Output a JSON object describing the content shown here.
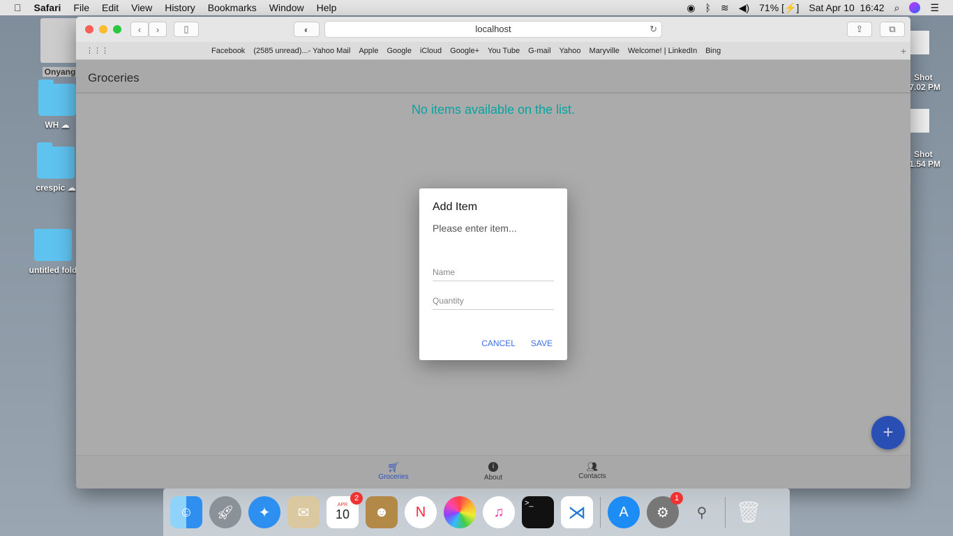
{
  "menubar": {
    "app": "Safari",
    "items": [
      "File",
      "Edit",
      "View",
      "History",
      "Bookmarks",
      "Window",
      "Help"
    ],
    "battery": "71%",
    "datetime": "Sat Apr 10  16:42"
  },
  "desktop": {
    "left": [
      "Onyang",
      "WH",
      "crespic",
      "untitled fold"
    ],
    "right": [
      {
        "l1": "Shot",
        "l2": ".7.02 PM"
      },
      {
        "l1": "Shot",
        "l2": ".1.54 PM"
      }
    ]
  },
  "browser": {
    "url": "localhost",
    "bookmarks": [
      "Facebook",
      "(2585 unread)...- Yahoo Mail",
      "Apple",
      "Google",
      "iCloud",
      "Google+",
      "You Tube",
      "G-mail",
      "Yahoo",
      "Maryville",
      "Welcome! | LinkedIn",
      "Bing"
    ]
  },
  "app": {
    "title": "Groceries",
    "empty_message": "No items available on the list.",
    "fab": "+",
    "tabs": [
      {
        "label": "Groceries",
        "icon": "cart-icon"
      },
      {
        "label": "About",
        "icon": "info-icon"
      },
      {
        "label": "Contacts",
        "icon": "people-icon"
      }
    ]
  },
  "dialog": {
    "title": "Add Item",
    "message": "Please enter item...",
    "name_placeholder": "Name",
    "quantity_placeholder": "Quantity",
    "cancel": "CANCEL",
    "save": "SAVE"
  },
  "dock": {
    "calendar_month": "APR",
    "calendar_day": "10",
    "calendar_badge": "2",
    "prefs_badge": "1"
  },
  "colors": {
    "accent": "#3a6fe6",
    "empty_text": "#07a3a0",
    "fab": "#2a4fb4"
  }
}
